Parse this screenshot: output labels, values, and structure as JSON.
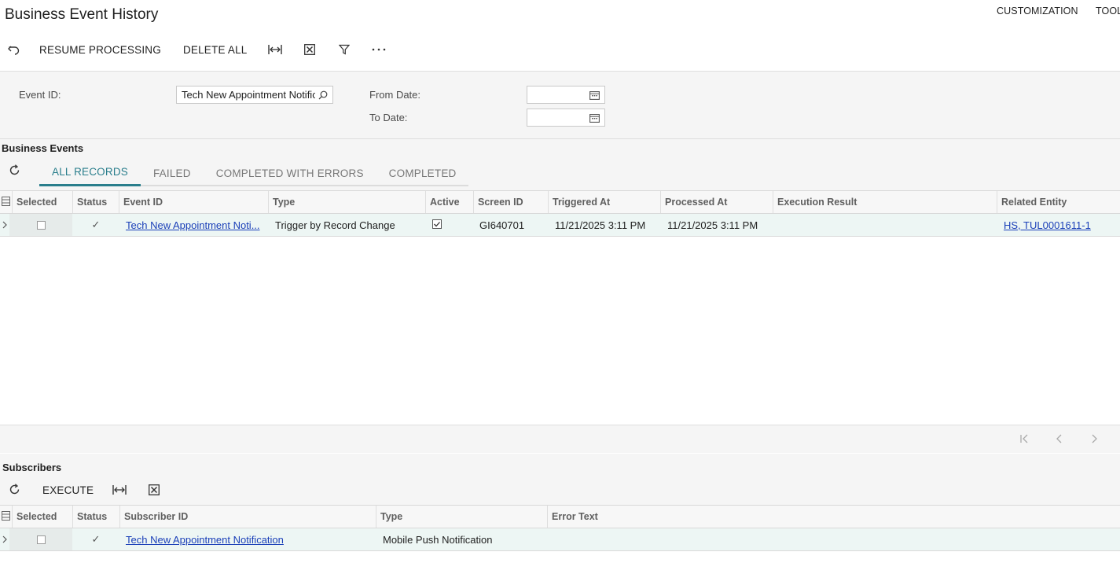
{
  "page": {
    "title": "Business Event History",
    "top_links": [
      "CUSTOMIZATION",
      "TOOL"
    ]
  },
  "toolbar": {
    "resume_label": "RESUME PROCESSING",
    "delete_all_label": "DELETE ALL",
    "icons": [
      "undo-icon",
      "fit-columns-icon",
      "excel-export-icon",
      "filter-icon",
      "more-icon"
    ]
  },
  "filters": {
    "event_id_label": "Event ID:",
    "event_id_value": "Tech New Appointment Notific",
    "from_date_label": "From Date:",
    "from_date_value": "",
    "to_date_label": "To Date:",
    "to_date_value": ""
  },
  "business_events": {
    "title": "Business Events",
    "tabs": [
      {
        "label": "ALL RECORDS",
        "active": true
      },
      {
        "label": "FAILED",
        "active": false
      },
      {
        "label": "COMPLETED WITH ERRORS",
        "active": false
      },
      {
        "label": "COMPLETED",
        "active": false
      }
    ],
    "columns": [
      "Selected",
      "Status",
      "Event ID",
      "Type",
      "Active",
      "Screen ID",
      "Triggered At",
      "Processed At",
      "Execution Result",
      "Related Entity"
    ],
    "rows": [
      {
        "selected": false,
        "status": "✓",
        "event_id": "Tech New Appointment Noti...",
        "type": "Trigger by Record Change",
        "active": true,
        "screen_id": "GI640701",
        "triggered_at": "11/21/2025 3:11 PM",
        "processed_at": "11/21/2025 3:11 PM",
        "execution_result": "",
        "related_entity": "HS, TUL0001611-1"
      }
    ]
  },
  "subscribers": {
    "title": "Subscribers",
    "execute_label": "EXECUTE",
    "columns": [
      "Selected",
      "Status",
      "Subscriber ID",
      "Type",
      "Error Text"
    ],
    "rows": [
      {
        "selected": false,
        "status": "✓",
        "subscriber_id": "Tech New Appointment Notification",
        "type": "Mobile Push Notification",
        "error_text": ""
      }
    ]
  },
  "colors": {
    "accent": "#2a7e8c",
    "link": "#1a3fb8",
    "row_highlight": "#edf6f4",
    "section_bg": "#f5f5f5"
  }
}
